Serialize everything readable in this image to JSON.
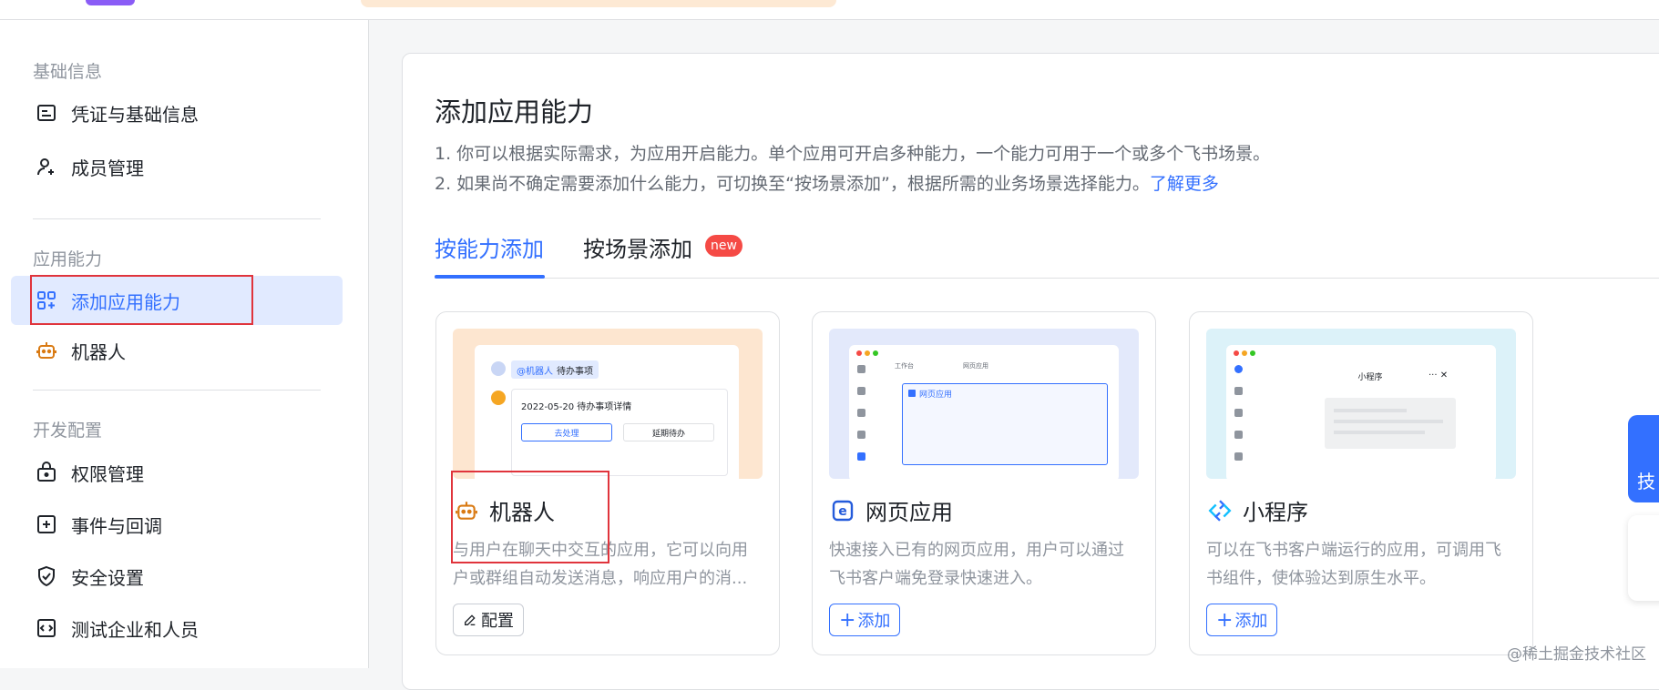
{
  "sidebar": {
    "groups": [
      {
        "title": "基础信息",
        "items": [
          {
            "label": "凭证与基础信息",
            "icon": "credential-card-icon"
          },
          {
            "label": "成员管理",
            "icon": "add-member-icon"
          }
        ]
      },
      {
        "title": "应用能力",
        "items": [
          {
            "label": "添加应用能力",
            "icon": "add-capability-grid-icon",
            "active": true
          },
          {
            "label": "机器人",
            "icon": "robot-icon"
          }
        ]
      },
      {
        "title": "开发配置",
        "items": [
          {
            "label": "权限管理",
            "icon": "lock-box-icon"
          },
          {
            "label": "事件与回调",
            "icon": "event-plus-icon"
          },
          {
            "label": "安全设置",
            "icon": "shield-check-icon"
          },
          {
            "label": "测试企业和人员",
            "icon": "code-box-icon"
          }
        ]
      }
    ]
  },
  "main": {
    "title": "添加应用能力",
    "desc_line1": "1. 你可以根据实际需求，为应用开启能力。单个应用可开启多种能力，一个能力可用于一个或多个飞书场景。",
    "desc_line2": "2. 如果尚不确定需要添加什么能力，可切换至“按场景添加”，根据所需的业务场景选择能力。",
    "learn_more": "了解更多",
    "tabs": [
      {
        "label": "按能力添加",
        "active": true
      },
      {
        "label": "按场景添加",
        "badge": "new"
      }
    ]
  },
  "cards": [
    {
      "title": "机器人",
      "desc": "与用户在聊天中交互的应用，它可以向用户或群组自动发送消息，响应用户的消...",
      "button": "配置",
      "button_icon": "pencil-icon",
      "preview": {
        "tag": "@机器人",
        "tag_text": "待办事项",
        "message": "2022-05-20 待办事项详情",
        "btn_primary": "去处理",
        "btn_secondary": "延期待办"
      }
    },
    {
      "title": "网页应用",
      "desc": "快速接入已有的网页应用，用户可以通过飞书客户端免登录快速进入。",
      "button": "添加",
      "button_icon": "plus-icon",
      "preview": {
        "tab1": "工作台",
        "tab2": "网页应用",
        "window_label": "网页应用"
      }
    },
    {
      "title": "小程序",
      "desc": "可以在飞书客户端运行的应用，可调用飞书组件，使体验达到原生水平。",
      "button": "添加",
      "button_icon": "plus-icon",
      "preview": {
        "window_title": "小程序",
        "window_controls": "··· ✕"
      }
    }
  ],
  "floating": {
    "button_text": "技"
  },
  "watermark": "@稀土掘金技术社区",
  "colors": {
    "accent": "#3370ff",
    "active_bg": "#e1eaff",
    "badge": "#f54a45",
    "annotation_red": "#e0343c"
  }
}
